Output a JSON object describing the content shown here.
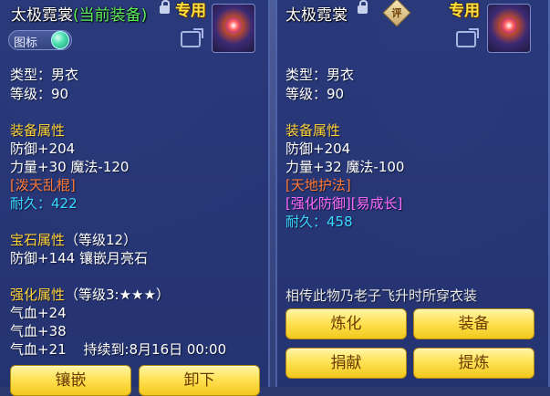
{
  "left_panel": {
    "item_name": "太极霓裳",
    "current_equip": "(当前装备)",
    "special": "专用",
    "icon_toggle_label": "图标",
    "type": "类型：男衣",
    "level": "等级：90",
    "attr_heading": "装备属性",
    "defense": "防御+204",
    "stats": "力量+30 魔法-120",
    "special_effect": "[泼天乱棍]",
    "durability_label": "耐久：",
    "durability_value": "422",
    "gem_heading": "宝石属性",
    "gem_level": "（等级12）",
    "gem_effect": "防御+144 镶嵌月亮石",
    "enhance_heading": "强化属性",
    "enhance_level": "（等级3:★★★）",
    "enhance_1": "气血+24",
    "enhance_2": "气血+38",
    "enhance_3": "气血+21",
    "duration": "持续到:8月16日 00:00",
    "btn_embed": "镶嵌",
    "btn_unequip": "卸下"
  },
  "right_panel": {
    "item_name": "太极霓裳",
    "rating_badge": "评",
    "special": "专用",
    "type": "类型：男衣",
    "level": "等级：90",
    "attr_heading": "装备属性",
    "defense": "防御+204",
    "stats": "力量+32 魔法-100",
    "special_effect": "[天地护法]",
    "special_tags": "[强化防御][易成长]",
    "durability_label": "耐久：",
    "durability_value": "458",
    "lore": "相传此物乃老子飞升时所穿衣装",
    "btn_refine": "炼化",
    "btn_equip": "装备",
    "btn_donate": "捐献",
    "btn_extract": "提炼"
  },
  "colors": {
    "panel_bg": "#26367a",
    "heading": "#ffd23a",
    "current_equip": "#5ff05f",
    "special": "#ffe23a",
    "effect_red": "#ff7a3a",
    "effect_pink": "#ff6aff",
    "durability": "#3ad8ff",
    "button": "#ffe256"
  },
  "icons": [
    "lock-icon",
    "item-icon",
    "share-icon",
    "rating-icon",
    "toggle-knob-icon"
  ]
}
